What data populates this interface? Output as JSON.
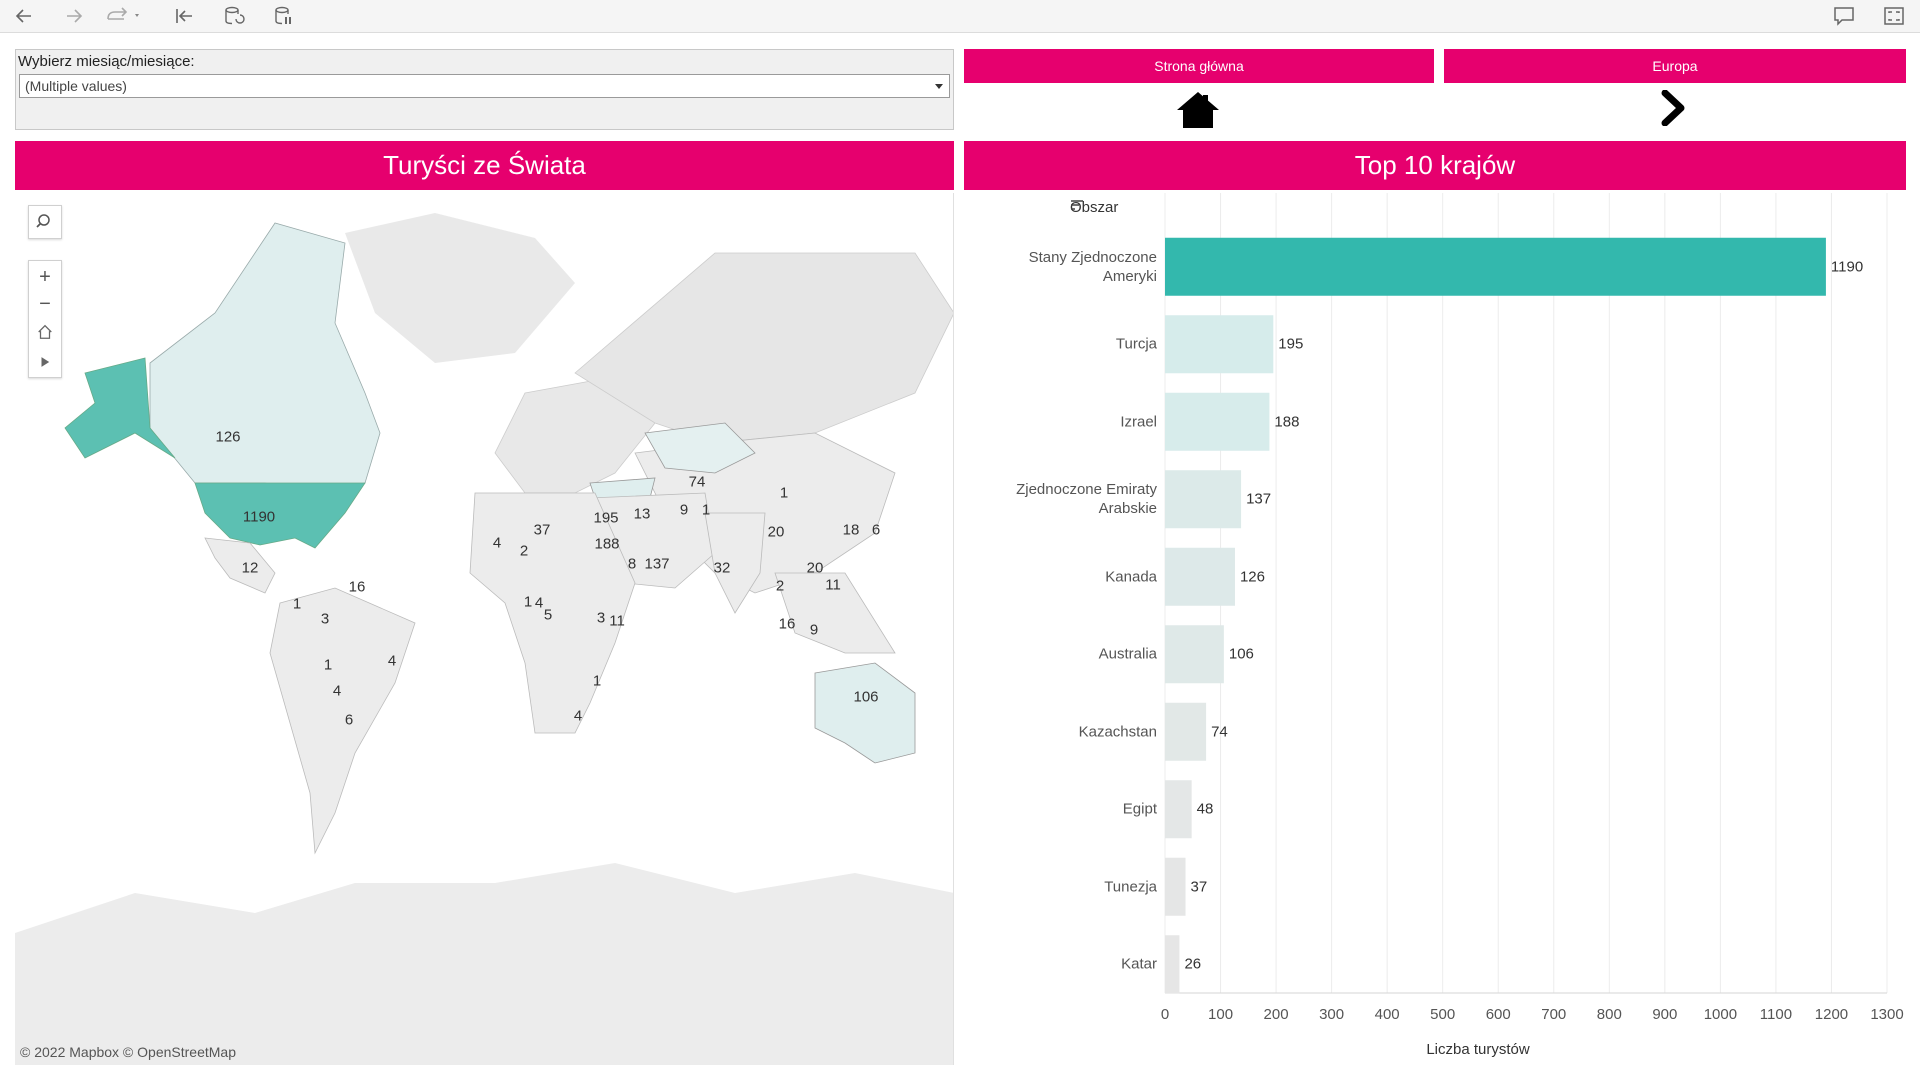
{
  "toolbar": {
    "icons": [
      "undo-icon",
      "redo-icon",
      "revert-icon",
      "revert-start-icon",
      "refresh-icon",
      "pause-updates-icon",
      "comment-icon",
      "fullscreen-icon"
    ]
  },
  "filter": {
    "label": "Wybierz miesiąc/miesiące:",
    "value": "(Multiple values)"
  },
  "nav": {
    "home_label": "Strona główna",
    "europe_label": "Europa"
  },
  "map_section": {
    "title": "Turyści ze Świata",
    "attribution": "© 2022 Mapbox  © OpenStreetMap",
    "highlight_color": "#5cc0b2",
    "light_color": "#dfeeee",
    "land_color": "#e8e8e8",
    "labels": [
      {
        "text": "126"
      },
      {
        "text": "1190"
      },
      {
        "text": "12"
      },
      {
        "text": "16"
      },
      {
        "text": "1"
      },
      {
        "text": "3"
      },
      {
        "text": "4"
      },
      {
        "text": "1"
      },
      {
        "text": "4"
      },
      {
        "text": "6"
      },
      {
        "text": "74"
      },
      {
        "text": "1"
      },
      {
        "text": "195"
      },
      {
        "text": "13"
      },
      {
        "text": "9"
      },
      {
        "text": "1"
      },
      {
        "text": "4"
      },
      {
        "text": "37"
      },
      {
        "text": "2"
      },
      {
        "text": "188"
      },
      {
        "text": "8"
      },
      {
        "text": "137"
      },
      {
        "text": "32"
      },
      {
        "text": "20"
      },
      {
        "text": "18"
      },
      {
        "text": "6"
      },
      {
        "text": "20"
      },
      {
        "text": "2"
      },
      {
        "text": "11"
      },
      {
        "text": "16"
      },
      {
        "text": "9"
      },
      {
        "text": "1"
      },
      {
        "text": "4"
      },
      {
        "text": "5"
      },
      {
        "text": "3"
      },
      {
        "text": "11"
      },
      {
        "text": "1"
      },
      {
        "text": "4"
      },
      {
        "text": "106"
      }
    ]
  },
  "chart_section": {
    "title": "Top 10 krajów",
    "sort_label": "Obszar"
  },
  "chart_data": {
    "type": "bar",
    "orientation": "horizontal",
    "categories": [
      "Stany Zjednoczone Ameryki",
      "Turcja",
      "Izrael",
      "Zjednoczone Emiraty Arabskie",
      "Kanada",
      "Australia",
      "Kazachstan",
      "Egipt",
      "Tunezja",
      "Katar"
    ],
    "category_lines": [
      [
        "Stany Zjednoczone",
        "Ameryki"
      ],
      [
        "Turcja"
      ],
      [
        "Izrael"
      ],
      [
        "Zjednoczone Emiraty",
        "Arabskie"
      ],
      [
        "Kanada"
      ],
      [
        "Australia"
      ],
      [
        "Kazachstan"
      ],
      [
        "Egipt"
      ],
      [
        "Tunezja"
      ],
      [
        "Katar"
      ]
    ],
    "values": [
      1190,
      195,
      188,
      137,
      126,
      106,
      74,
      48,
      37,
      26
    ],
    "xlabel": "Liczba turystów",
    "xlim": [
      0,
      1300
    ],
    "xticks": [
      0,
      100,
      200,
      300,
      400,
      500,
      600,
      700,
      800,
      900,
      1000,
      1100,
      1200,
      1300
    ],
    "grid": true,
    "colors": {
      "max": "#33b8ad",
      "low": "#e6e6e6",
      "high": "#d6eceb"
    }
  }
}
